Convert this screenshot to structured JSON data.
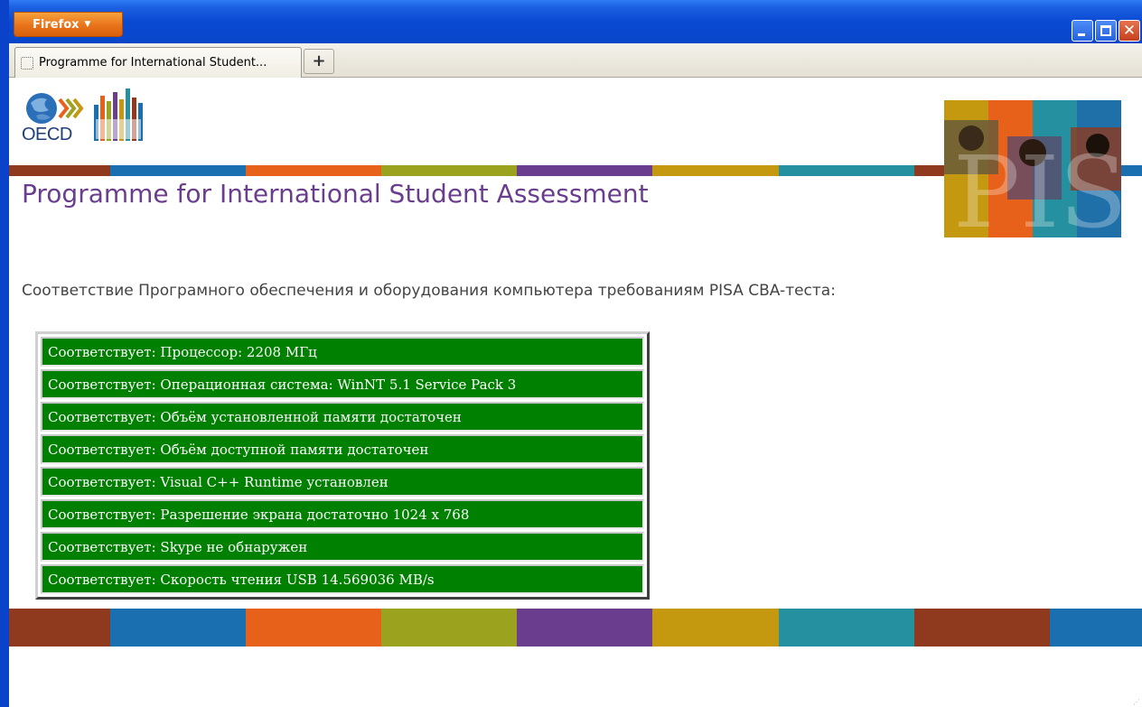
{
  "window": {
    "firefox_menu_label": "Firefox",
    "caret": "▼",
    "close_glyph": "✕"
  },
  "tabs": [
    {
      "title": "Programme for International Student..."
    }
  ],
  "new_tab_label": "+",
  "logo": {
    "text": "OECD"
  },
  "page": {
    "title": "Programme for International Student Assessment",
    "subtitle": "Соответствие Програмного обеспечения и оборудования компьютера требованиям PISA CBA-теста:"
  },
  "checks": [
    "Соответствует: Процессор: 2208 МГц",
    "Соответствует: Операционная система: WinNT 5.1 Service Pack 3",
    "Соответствует: Объём установленной памяти достаточен",
    "Соответствует: Объём доступной памяти достаточен",
    "Соответствует: Visual C++ Runtime установлен",
    "Соответствует: Разрешение экрана достаточно 1024 x 768",
    "Соответствует: Skype не обнаружен",
    "Соответствует: Скорость чтения USB 14.569036 MB/s"
  ],
  "colors": {
    "title": "#6a3d8f",
    "check_ok": "#008000",
    "stripe": [
      "#8f3a1e",
      "#1a6fb0",
      "#e8611a",
      "#9aa21e",
      "#6a3d8f",
      "#c4980f",
      "#2590a0",
      "#8f3a1e",
      "#1a6fb0"
    ]
  }
}
